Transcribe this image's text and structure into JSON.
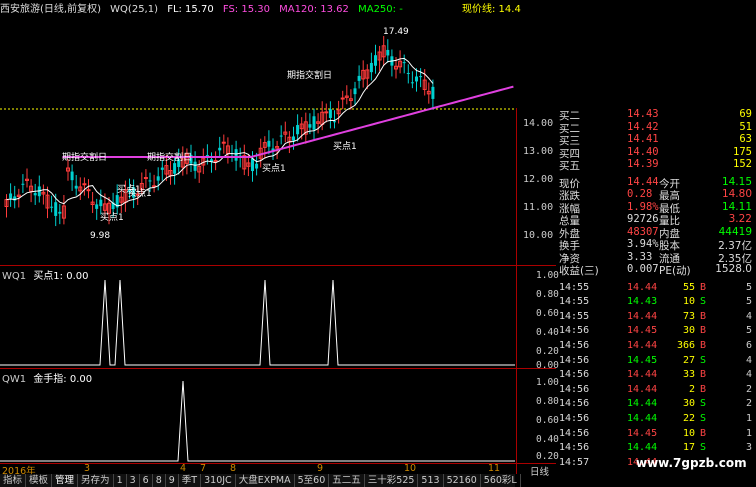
{
  "title_bar": {
    "name": "西安旅游(日线,前复权)",
    "indicator": "WQ(25,1)",
    "fl": "FL: 15.70",
    "fs": "FS: 15.30",
    "ma120": "MA120: 13.62",
    "ma250": "MA250: -",
    "current_price": "现价线: 14.4"
  },
  "main_chart": {
    "annotations": {
      "peak": "17.49",
      "low": "9.98",
      "label1": "期指交割日",
      "label2": "期指交割日",
      "label3": "期指交割日",
      "buy1": "买点1",
      "buy2": "买点1",
      "buy3": "买点1",
      "buy4": "买点1",
      "buy5": "买点1"
    },
    "colors": {
      "up": "#ff3b3b",
      "down": "#00d0d0",
      "ma120": "#e040e0",
      "line": "#ffffff"
    }
  },
  "price_axis": [
    "14.00",
    "13.00",
    "12.00",
    "11.00",
    "10.00"
  ],
  "quote": {
    "bid_rows": [
      {
        "label": "买二",
        "price": "14.43",
        "vol": "69"
      },
      {
        "label": "买二",
        "price": "14.42",
        "vol": "51"
      },
      {
        "label": "买三",
        "price": "14.41",
        "vol": "63"
      },
      {
        "label": "买四",
        "price": "14.40",
        "vol": "175"
      },
      {
        "label": "买五",
        "price": "14.39",
        "vol": "152"
      }
    ],
    "stats": [
      {
        "l": "现价",
        "v": "14.44",
        "l2": "今开",
        "v2": "14.15",
        "c1": "#f44",
        "c2": "#0f0"
      },
      {
        "l": "涨跌",
        "v": "0.28",
        "l2": "最高",
        "v2": "14.80",
        "c1": "#f44",
        "c2": "#f44"
      },
      {
        "l": "涨幅",
        "v": "1.98%",
        "l2": "最低",
        "v2": "14.11",
        "c1": "#f44",
        "c2": "#0f0"
      },
      {
        "l": "总量",
        "v": "92726",
        "l2": "量比",
        "v2": "3.22",
        "c1": "#ddd",
        "c2": "#f44"
      },
      {
        "l": "外盘",
        "v": "48307",
        "l2": "内盘",
        "v2": "44419",
        "c1": "#f44",
        "c2": "#0f0"
      },
      {
        "l": "换手",
        "v": "3.94%",
        "l2": "股本",
        "v2": "2.37亿",
        "c1": "#ddd",
        "c2": "#ddd"
      },
      {
        "l": "净资",
        "v": "3.33",
        "l2": "流通",
        "v2": "2.35亿",
        "c1": "#ddd",
        "c2": "#ddd"
      },
      {
        "l": "收益(三)",
        "v": "0.007",
        "l2": "PE(动)",
        "v2": "1528.0",
        "c1": "#ddd",
        "c2": "#ddd"
      }
    ],
    "ticks": [
      {
        "t": "14:55",
        "p": "14.44",
        "v": "55",
        "bs": "B",
        "n": "5",
        "c": "#f44"
      },
      {
        "t": "14:55",
        "p": "14.43",
        "v": "10",
        "bs": "S",
        "n": "5",
        "c": "#0f0"
      },
      {
        "t": "14:55",
        "p": "14.44",
        "v": "73",
        "bs": "B",
        "n": "4",
        "c": "#f44"
      },
      {
        "t": "14:56",
        "p": "14.45",
        "v": "30",
        "bs": "B",
        "n": "5",
        "c": "#f44"
      },
      {
        "t": "14:56",
        "p": "14.44",
        "v": "366",
        "bs": "B",
        "n": "6",
        "c": "#f44"
      },
      {
        "t": "14:56",
        "p": "14.45",
        "v": "27",
        "bs": "S",
        "n": "4",
        "c": "#0f0"
      },
      {
        "t": "14:56",
        "p": "14.44",
        "v": "33",
        "bs": "B",
        "n": "4",
        "c": "#f44"
      },
      {
        "t": "14:56",
        "p": "14.44",
        "v": "2",
        "bs": "B",
        "n": "2",
        "c": "#f44"
      },
      {
        "t": "14:56",
        "p": "14.44",
        "v": "30",
        "bs": "S",
        "n": "2",
        "c": "#0f0"
      },
      {
        "t": "14:56",
        "p": "14.44",
        "v": "22",
        "bs": "S",
        "n": "1",
        "c": "#0f0"
      },
      {
        "t": "14:56",
        "p": "14.45",
        "v": "10",
        "bs": "B",
        "n": "1",
        "c": "#f44"
      },
      {
        "t": "14:56",
        "p": "14.44",
        "v": "17",
        "bs": "S",
        "n": "3",
        "c": "#0f0"
      },
      {
        "t": "14:57",
        "p": "14.44",
        "v": "",
        "bs": "",
        "n": "",
        "c": "#f44"
      }
    ]
  },
  "sub1": {
    "name": "WQ1",
    "label": "买点1: 0.00",
    "axis": [
      "1.00",
      "0.80",
      "0.60",
      "0.40",
      "0.20",
      "0.00"
    ]
  },
  "sub2": {
    "name": "QW1",
    "label": "金手指: 0.00",
    "axis": [
      "1.00",
      "0.80",
      "0.60",
      "0.40",
      "0.20"
    ]
  },
  "date_axis": {
    "year": "2016年",
    "months": [
      "3",
      "4",
      "7",
      "8",
      "9",
      "10",
      "11"
    ],
    "period": "日线"
  },
  "bottom_tabs": [
    "指标",
    "模板",
    "管理",
    "另存为",
    "1",
    "3",
    "6",
    "8",
    "9",
    "季T",
    "310JC",
    "大盘EXPMA",
    "5至60",
    "五二五",
    "三十彩525",
    "513",
    "52160",
    "560彩L"
  ],
  "watermark": "www.7gpzb.com"
}
